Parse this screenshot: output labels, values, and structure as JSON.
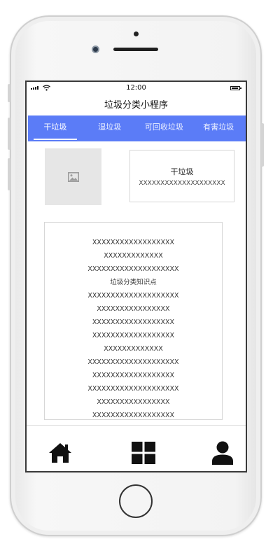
{
  "status_bar": {
    "time": "12:00"
  },
  "app": {
    "title": "垃圾分类小程序"
  },
  "tabs": [
    {
      "label": "干垃圾",
      "active": true
    },
    {
      "label": "湿垃圾",
      "active": false
    },
    {
      "label": "可回收垃圾",
      "active": false
    },
    {
      "label": "有害垃圾",
      "active": false
    }
  ],
  "featured": {
    "image_icon": "image-icon",
    "title": "干垃圾",
    "subtitle": "XXXXXXXXXXXXXXXXXXXX"
  },
  "content": {
    "lines": [
      "XXXXXXXXXXXXXXXXXX",
      "XXXXXXXXXXXXX",
      "XXXXXXXXXXXXXXXXXXXX",
      "垃圾分类知识点",
      "XXXXXXXXXXXXXXXXXXXX",
      "XXXXXXXXXXXXXXXX",
      "XXXXXXXXXXXXXXXXXX",
      "XXXXXXXXXXXXXXXXXX",
      "XXXXXXXXXXXXX",
      "XXXXXXXXXXXXXXXXXXXX",
      "XXXXXXXXXXXXXXXXXX",
      "XXXXXXXXXXXXXXXXXXXX",
      "XXXXXXXXXXXXXXXX",
      "XXXXXXXXXXXXXXXXXX"
    ]
  },
  "bottom_nav": [
    {
      "icon": "home-icon"
    },
    {
      "icon": "grid-icon"
    },
    {
      "icon": "user-icon"
    }
  ],
  "colors": {
    "accent": "#5b7cf7",
    "icon": "#111111",
    "placeholder": "#e6e6e6"
  }
}
